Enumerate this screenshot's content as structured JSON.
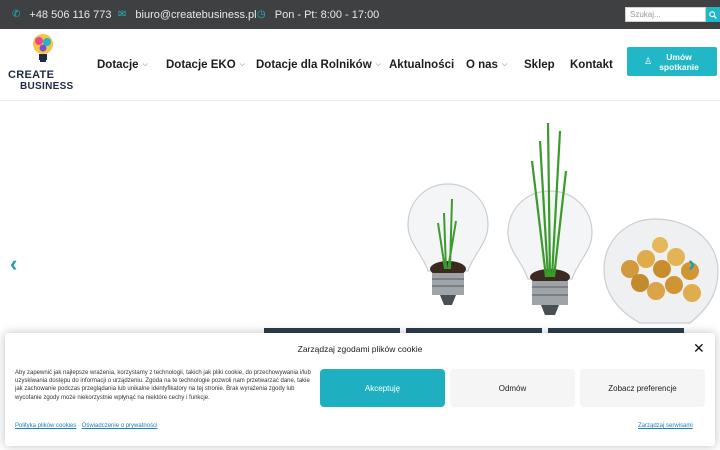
{
  "topbar": {
    "phone": "+48 506 116 773",
    "email": "biuro@createbusiness.pl",
    "hours": "Pon - Pt: 8:00 - 17:00",
    "search_placeholder": "Szukaj..."
  },
  "logo": {
    "line1": "CREATE",
    "line2": "BUSINESS"
  },
  "nav": {
    "items": [
      {
        "label": "Dotacje",
        "has_dropdown": true
      },
      {
        "label": "Dotacje EKO",
        "has_dropdown": true
      },
      {
        "label": "Dotacje dla Rolników",
        "has_dropdown": true
      },
      {
        "label": "Aktualności",
        "has_dropdown": false
      },
      {
        "label": "O nas",
        "has_dropdown": true
      },
      {
        "label": "Sklep",
        "has_dropdown": false
      },
      {
        "label": "Kontakt",
        "has_dropdown": false
      }
    ],
    "cta_label": "Umów spotkanie"
  },
  "cookie": {
    "title": "Zarządzaj zgodami plików cookie",
    "description": "Aby zapewnić jak najlepsze wrażenia, korzystamy z technologii, takich jak pliki cookie, do przechowywania i/lub uzyskiwania dostępu do informacji o urządzeniu. Zgoda na te technologie pozwoli nam przetwarzać dane, takie jak zachowanie podczas przeglądania lub unikalne identyfikatory na tej stronie. Brak wyrażenia zgody lub wycofanie zgody może niekorzystnie wpłynąć na niektóre cechy i funkcje.",
    "accept_label": "Akceptuję",
    "deny_label": "Odmów",
    "prefs_label": "Zobacz preferencje",
    "policy_link": "Polityka plików cookies",
    "privacy_link": "Oświadczenie o prywatności",
    "manage_link": "Zarządzaj serwisami"
  },
  "colors": {
    "accent": "#21b7c7",
    "topbar_bg": "#3f4041",
    "nav_text": "#1d1d1d"
  },
  "icons": [
    "phone-icon",
    "envelope-icon",
    "clock-icon",
    "search-icon",
    "user-icon",
    "chevron-down-icon",
    "chevron-left-icon",
    "chevron-right-icon",
    "close-icon"
  ]
}
